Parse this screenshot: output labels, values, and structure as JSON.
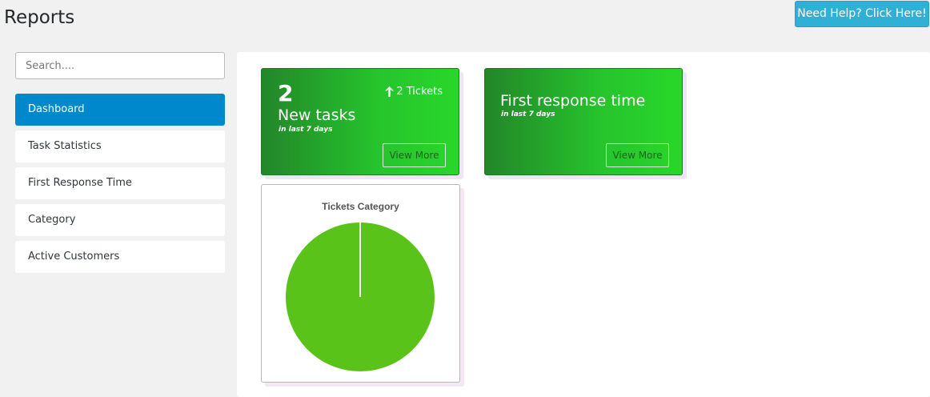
{
  "page": {
    "title": "Reports"
  },
  "help_button": {
    "label": "Need Help? Click Here!"
  },
  "sidebar": {
    "search_placeholder": "Search....",
    "items": [
      {
        "label": "Dashboard",
        "active": true
      },
      {
        "label": "Task Statistics",
        "active": false
      },
      {
        "label": "First Response Time",
        "active": false
      },
      {
        "label": "Category",
        "active": false
      },
      {
        "label": "Active Customers",
        "active": false
      }
    ]
  },
  "cards": {
    "new_tasks": {
      "count": "2",
      "title": "New tasks",
      "subtitle": "in last 7 days",
      "trend": "2 Tickets",
      "trend_icon": "arrow-up-icon",
      "button": "View More"
    },
    "first_response": {
      "title": "First response time",
      "subtitle": "in last 7 days",
      "button": "View More"
    }
  },
  "colors": {
    "accent": "#0088cc",
    "help": "#31b0d5",
    "card_green_dark": "#23862a",
    "card_green_light": "#28d72a",
    "pie": "#5ac31a"
  },
  "chart_data": {
    "type": "pie",
    "title": "Tickets Category",
    "series": [
      {
        "values": [
          100
        ]
      }
    ],
    "colors": [
      "#5ac31a"
    ]
  }
}
